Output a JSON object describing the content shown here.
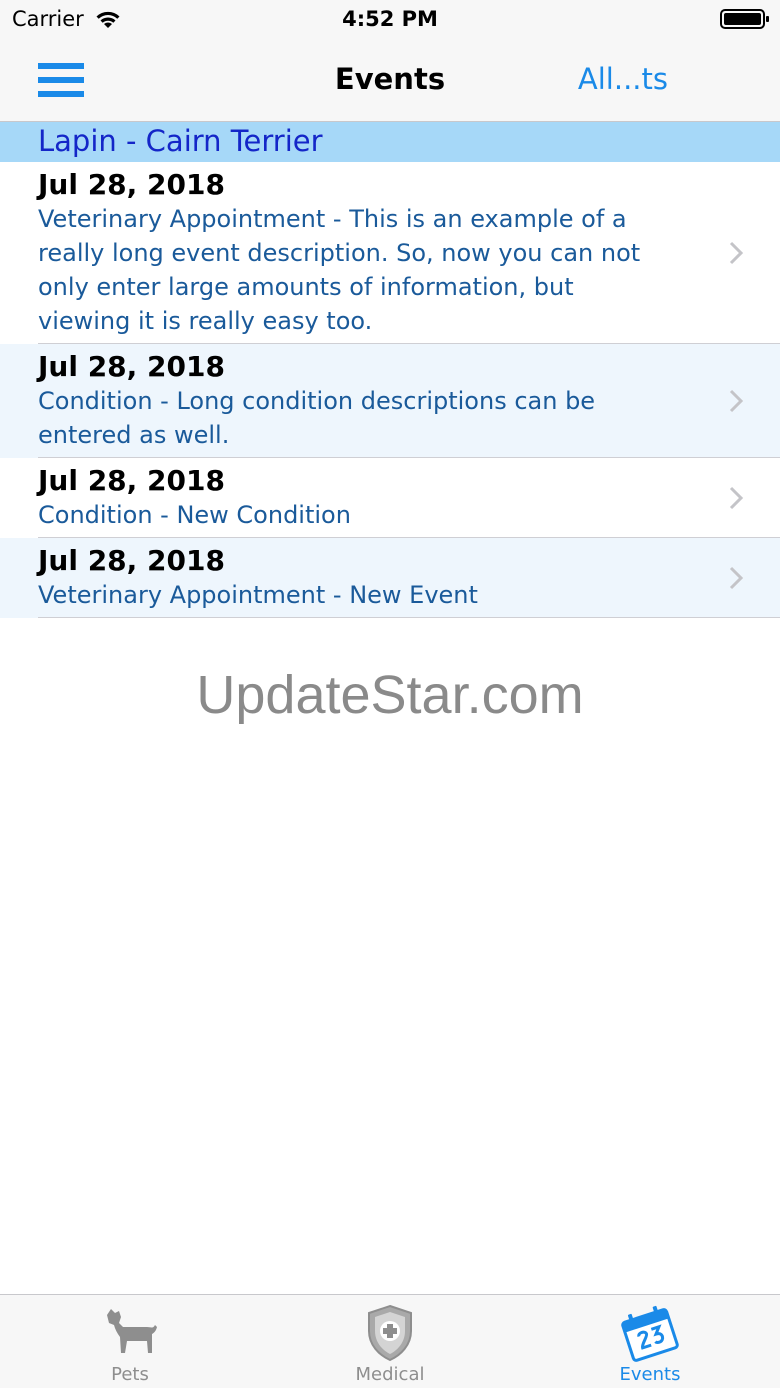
{
  "status_bar": {
    "carrier": "Carrier",
    "time": "4:52 PM"
  },
  "nav": {
    "title": "Events",
    "right_button": "All...ts",
    "menu_icon": "hamburger-menu-icon",
    "accent_color": "#1a8ae8"
  },
  "section": {
    "title": "Lapin - Cairn Terrier",
    "background_color": "#a6d8f8"
  },
  "events": [
    {
      "date": "Jul 28, 2018",
      "description": "Veterinary Appointment - This is an example of a really long event description. So, now you can not only enter large amounts of information, but viewing it is really easy too."
    },
    {
      "date": "Jul 28, 2018",
      "description": "Condition - Long condition descriptions can be entered as well."
    },
    {
      "date": "Jul 28, 2018",
      "description": "Condition - New Condition"
    },
    {
      "date": "Jul 28, 2018",
      "description": "Veterinary Appointment - New Event"
    }
  ],
  "watermark": "UpdateStar.com",
  "tabs": [
    {
      "label": "Pets",
      "icon": "dog-icon",
      "active": false
    },
    {
      "label": "Medical",
      "icon": "medical-shield-icon",
      "active": false
    },
    {
      "label": "Events",
      "icon": "calendar-icon",
      "active": true
    }
  ]
}
